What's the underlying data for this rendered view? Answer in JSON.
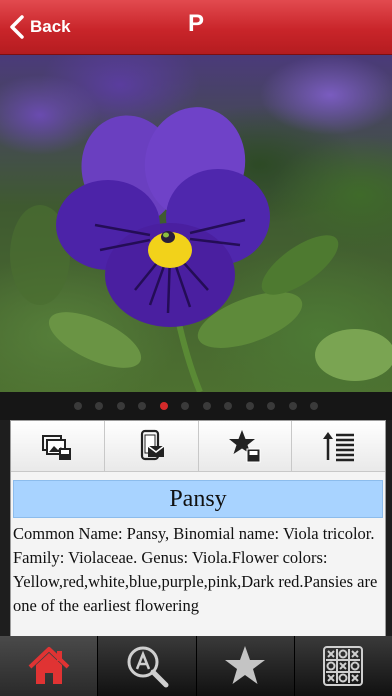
{
  "nav": {
    "back_label": "Back",
    "title": "P"
  },
  "gallery": {
    "dot_count": 12,
    "active_index": 4
  },
  "toolbar": {
    "icons": [
      "save-photo-icon",
      "mobile-share-icon",
      "favorite-save-icon",
      "text-size-icon"
    ]
  },
  "detail": {
    "title": "Pansy",
    "description": "Common Name: Pansy, Binomial name: Viola tricolor. Family: Violaceae. Genus: Viola.Flower colors: Yellow,red,white,blue,purple,pink,Dark red.Pansies are one of the earliest flowering"
  },
  "tabs": {
    "icons": [
      "home-icon",
      "search-a-icon",
      "star-icon",
      "tic-tac-toe-icon"
    ],
    "active_index": 0
  },
  "colors": {
    "nav_red": "#c9252a",
    "active_dot": "#d42a2a",
    "title_highlight": "#a8d3ff",
    "home_icon_red": "#e03333"
  }
}
